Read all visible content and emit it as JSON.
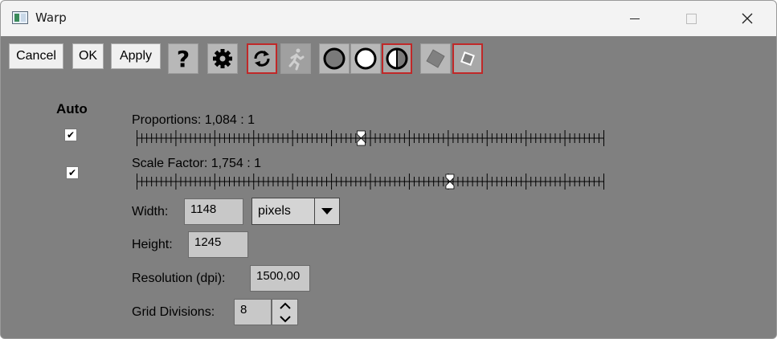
{
  "window": {
    "title": "Warp",
    "icon": "app-window-icon"
  },
  "toolbar": {
    "cancel_label": "Cancel",
    "ok_label": "OK",
    "apply_label": "Apply",
    "help_icon": "question-icon",
    "settings_icon": "gear-icon",
    "refresh_icon": "refresh-icon",
    "run_icon": "running-man-icon",
    "accent_color": "#c02828"
  },
  "auto": {
    "label": "Auto",
    "proportions_checked": true,
    "scale_checked": true
  },
  "proportions": {
    "label": "Proportions: 1,084 : 1",
    "value": 0.48
  },
  "scale_factor": {
    "label": "Scale Factor: 1,754 : 1",
    "value": 0.67
  },
  "width": {
    "label": "Width:",
    "value": "1148",
    "unit": "pixels"
  },
  "height": {
    "label": "Height:",
    "value": "1245"
  },
  "resolution": {
    "label": "Resolution (dpi):",
    "value": "1500,00"
  },
  "grid": {
    "label": "Grid Divisions:",
    "value": "8"
  }
}
